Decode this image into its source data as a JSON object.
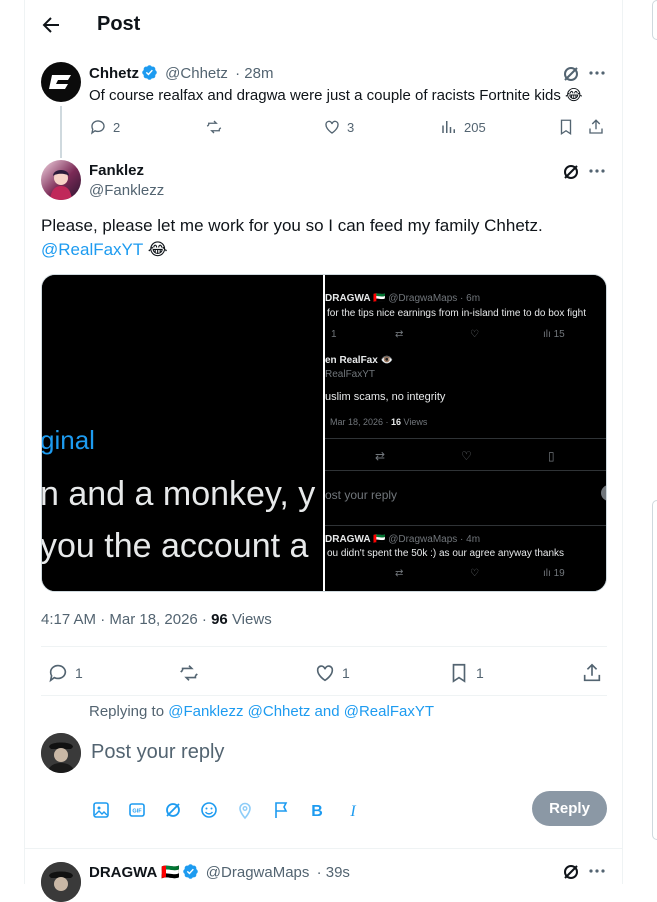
{
  "header": {
    "title": "Post"
  },
  "parent": {
    "name": "Chhetz",
    "handle": "@Chhetz",
    "time": "· 28m",
    "text": "Of course realfax and dragwa were just a couple of racists Fortnite kids 😂",
    "replies": "2",
    "likes": "3",
    "views": "205"
  },
  "main": {
    "name": "Fanklez",
    "handle": "@Fanklezz",
    "text_line1": "Please, please let me work for you so I can feed my family Chhetz.",
    "mention": "@RealFaxYT",
    "emoji": "😂",
    "timestamp": "4:17 AM · Mar 18, 2026 · ",
    "views_count": "96",
    "views_label": " Views",
    "replies": "1",
    "likes": "1",
    "bookmarks": "1"
  },
  "media": {
    "left_text": [
      "ginal",
      "n and a monkey, y",
      "you the account a"
    ],
    "right": {
      "t1_name": "DRAGWA 🇦🇪",
      "t1_handle": "@DragwaMaps · 6m",
      "t1_text": "for the tips nice earnings from in-island time to do box fight",
      "t1_replies": "1",
      "t1_views": "15",
      "t2_name": "en RealFax 👁️",
      "t2_handle": "RealFaxYT",
      "t2_text": "uslim scams, no integrity",
      "t2_time": "Mar 18, 2026 · ",
      "t2_views": "16",
      "t2_views_label": " Views",
      "reply_ph": "ost your reply",
      "t3_name": "DRAGWA 🇦🇪",
      "t3_handle": "@DragwaMaps · 4m",
      "t3_text": "ou didn't spent the 50k :) as our agree anyway thanks",
      "t3_views": "19"
    }
  },
  "reply": {
    "replying_to_label": "Replying to ",
    "replying_to_users": "@Fanklezz @Chhetz and @RealFaxYT",
    "placeholder": "Post your reply",
    "button": "Reply"
  },
  "next": {
    "name": "DRAGWA 🇦🇪",
    "handle": "@DragwaMaps",
    "time": "· 39s"
  },
  "colors": {
    "accent": "#1d9bf0",
    "text": "#0f1419",
    "secondary": "#536471",
    "reply_button": "#8b98a5"
  }
}
